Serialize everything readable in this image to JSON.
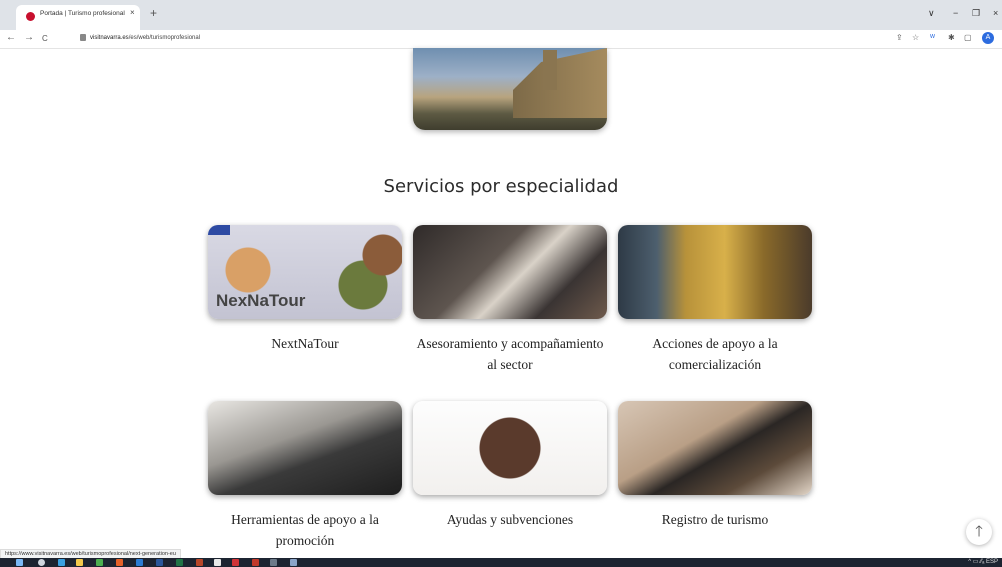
{
  "browser": {
    "tab_title": "Portada | Turismo profesional",
    "tab_close": "×",
    "new_tab": "+",
    "url_domain": "visitnavarra.es",
    "url_path": "/es/web/turismoprofesional",
    "profile_initial": "A",
    "win_controls": [
      "∨",
      "−",
      "❐",
      "×"
    ],
    "nav": {
      "back": "←",
      "forward": "→",
      "reload": "C"
    },
    "status_url": "https://www.visitnavarra.es/web/turismoprofesional/next-generation-eu"
  },
  "page": {
    "section_title": "Servicios por especialidad",
    "cards": [
      {
        "label": "NextNaTour",
        "logo_text": "NexNaTour"
      },
      {
        "label": "Asesoramiento y acompañamiento al sector"
      },
      {
        "label": "Acciones de apoyo a la comercialización"
      },
      {
        "label": "Herramientas de apoyo a la promoción"
      },
      {
        "label": "Ayudas y subvenciones"
      },
      {
        "label": "Registro de turismo"
      }
    ],
    "scroll_top": "🡑"
  },
  "taskbar": {
    "tray_text": "^ ▭ ⁄⁄ₐ ESP"
  },
  "colors": {
    "accent_red": "#c8102e",
    "tabbar_bg": "#dfe3e8",
    "taskbar_bg": "#1c2431"
  }
}
